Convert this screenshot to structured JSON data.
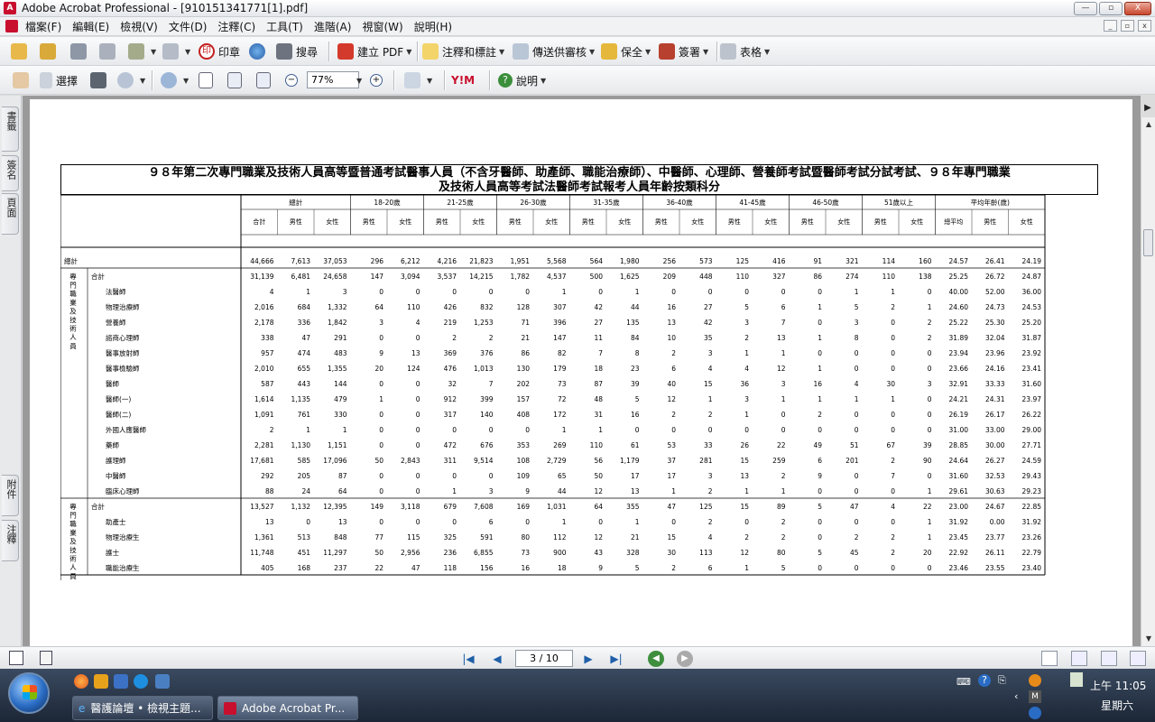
{
  "window": {
    "title": "Adobe Acrobat Professional - [910151341771[1].pdf]",
    "min": "—",
    "max": "▫",
    "close": "X"
  },
  "menubar": {
    "items": [
      "檔案(F)",
      "編輯(E)",
      "檢視(V)",
      "文件(D)",
      "注釋(C)",
      "工具(T)",
      "進階(A)",
      "視窗(W)",
      "說明(H)"
    ]
  },
  "toolbar1": {
    "stamp": "印章",
    "search": "搜尋",
    "create_pdf": "建立 PDF",
    "comment": "注釋和標註",
    "review": "傳送供審核",
    "secure": "保全",
    "sign": "簽署",
    "forms": "表格"
  },
  "toolbar2": {
    "select": "選擇",
    "zoom": "77%",
    "help": "說明"
  },
  "leftnav": {
    "tabs": [
      "書籤",
      "簽名",
      "頁面",
      "附件",
      "注釋"
    ]
  },
  "statusbar": {
    "page": "3 / 10"
  },
  "taskbar": {
    "items": [
      "醫護論壇 • 檢視主題...",
      "Adobe Acrobat Pr..."
    ],
    "time": "上午 11:05",
    "day": "星期六"
  },
  "document": {
    "title_line1": "９８年第二次專門職業及技術人員高等暨普通考試醫事人員（不含牙醫師、助產師、職能治療師）、中醫師、心理師、營養師考試暨醫師考試分試考試、９８年專門職業",
    "title_line2": "及技術人員高等考試法醫師考試報考人員年齡按類科分",
    "group_headers": [
      "總計",
      "18-20歲",
      "21-25歲",
      "26-30歲",
      "31-35歲",
      "36-40歲",
      "41-45歲",
      "46-50歲",
      "51歲以上",
      "平均年齡(歲)"
    ],
    "sub_headers": [
      "合計",
      "男性",
      "女性",
      "男性",
      "女性",
      "男性",
      "女性",
      "男性",
      "女性",
      "男性",
      "女性",
      "男性",
      "女性",
      "男性",
      "女性",
      "男性",
      "女性",
      "男性",
      "女性",
      "總平均",
      "男性",
      "女性"
    ],
    "total_label": "總計",
    "total_row": [
      "44,666",
      "7,613",
      "37,053",
      "296",
      "6,212",
      "4,216",
      "21,823",
      "1,951",
      "5,568",
      "564",
      "1,980",
      "256",
      "573",
      "125",
      "416",
      "91",
      "321",
      "114",
      "160",
      "24.57",
      "26.41",
      "24.19"
    ],
    "section1_label": "專門職業及技術人員高等考試",
    "section1_rows": [
      {
        "name": "合計",
        "v": [
          "31,139",
          "6,481",
          "24,658",
          "147",
          "3,094",
          "3,537",
          "14,215",
          "1,782",
          "4,537",
          "500",
          "1,625",
          "209",
          "448",
          "110",
          "327",
          "86",
          "274",
          "110",
          "138",
          "25.25",
          "26.72",
          "24.87"
        ]
      },
      {
        "name": "法醫師",
        "v": [
          "4",
          "1",
          "3",
          "0",
          "0",
          "0",
          "0",
          "0",
          "1",
          "0",
          "1",
          "0",
          "0",
          "0",
          "0",
          "0",
          "1",
          "1",
          "0",
          "40.00",
          "52.00",
          "36.00"
        ]
      },
      {
        "name": "物理治療師",
        "v": [
          "2,016",
          "684",
          "1,332",
          "64",
          "110",
          "426",
          "832",
          "128",
          "307",
          "42",
          "44",
          "16",
          "27",
          "5",
          "6",
          "1",
          "5",
          "2",
          "1",
          "24.60",
          "24.73",
          "24.53"
        ]
      },
      {
        "name": "營養師",
        "v": [
          "2,178",
          "336",
          "1,842",
          "3",
          "4",
          "219",
          "1,253",
          "71",
          "396",
          "27",
          "135",
          "13",
          "42",
          "3",
          "7",
          "0",
          "3",
          "0",
          "2",
          "25.22",
          "25.30",
          "25.20"
        ]
      },
      {
        "name": "諮商心理師",
        "v": [
          "338",
          "47",
          "291",
          "0",
          "0",
          "2",
          "2",
          "21",
          "147",
          "11",
          "84",
          "10",
          "35",
          "2",
          "13",
          "1",
          "8",
          "0",
          "2",
          "31.89",
          "32.04",
          "31.87"
        ]
      },
      {
        "name": "醫事放射師",
        "v": [
          "957",
          "474",
          "483",
          "9",
          "13",
          "369",
          "376",
          "86",
          "82",
          "7",
          "8",
          "2",
          "3",
          "1",
          "1",
          "0",
          "0",
          "0",
          "0",
          "23.94",
          "23.96",
          "23.92"
        ]
      },
      {
        "name": "醫事檢驗師",
        "v": [
          "2,010",
          "655",
          "1,355",
          "20",
          "124",
          "476",
          "1,013",
          "130",
          "179",
          "18",
          "23",
          "6",
          "4",
          "4",
          "12",
          "1",
          "0",
          "0",
          "0",
          "23.66",
          "24.16",
          "23.41"
        ]
      },
      {
        "name": "醫師",
        "v": [
          "587",
          "443",
          "144",
          "0",
          "0",
          "32",
          "7",
          "202",
          "73",
          "87",
          "39",
          "40",
          "15",
          "36",
          "3",
          "16",
          "4",
          "30",
          "3",
          "32.91",
          "33.33",
          "31.60"
        ]
      },
      {
        "name": "醫師(一)",
        "v": [
          "1,614",
          "1,135",
          "479",
          "1",
          "0",
          "912",
          "399",
          "157",
          "72",
          "48",
          "5",
          "12",
          "1",
          "3",
          "1",
          "1",
          "1",
          "1",
          "0",
          "24.21",
          "24.31",
          "23.97"
        ]
      },
      {
        "name": "醫師(二)",
        "v": [
          "1,091",
          "761",
          "330",
          "0",
          "0",
          "317",
          "140",
          "408",
          "172",
          "31",
          "16",
          "2",
          "2",
          "1",
          "0",
          "2",
          "0",
          "0",
          "0",
          "26.19",
          "26.17",
          "26.22"
        ]
      },
      {
        "name": "外國人應醫師",
        "v": [
          "2",
          "1",
          "1",
          "0",
          "0",
          "0",
          "0",
          "0",
          "1",
          "1",
          "0",
          "0",
          "0",
          "0",
          "0",
          "0",
          "0",
          "0",
          "0",
          "31.00",
          "33.00",
          "29.00"
        ]
      },
      {
        "name": "藥師",
        "v": [
          "2,281",
          "1,130",
          "1,151",
          "0",
          "0",
          "472",
          "676",
          "353",
          "269",
          "110",
          "61",
          "53",
          "33",
          "26",
          "22",
          "49",
          "51",
          "67",
          "39",
          "28.85",
          "30.00",
          "27.71"
        ]
      },
      {
        "name": "護理師",
        "v": [
          "17,681",
          "585",
          "17,096",
          "50",
          "2,843",
          "311",
          "9,514",
          "108",
          "2,729",
          "56",
          "1,179",
          "37",
          "281",
          "15",
          "259",
          "6",
          "201",
          "2",
          "90",
          "24.64",
          "26.27",
          "24.59"
        ]
      },
      {
        "name": "中醫師",
        "v": [
          "292",
          "205",
          "87",
          "0",
          "0",
          "0",
          "0",
          "109",
          "65",
          "50",
          "17",
          "17",
          "3",
          "13",
          "2",
          "9",
          "0",
          "7",
          "0",
          "31.60",
          "32.53",
          "29.43"
        ]
      },
      {
        "name": "臨床心理師",
        "v": [
          "88",
          "24",
          "64",
          "0",
          "0",
          "1",
          "3",
          "9",
          "44",
          "12",
          "13",
          "1",
          "2",
          "1",
          "1",
          "0",
          "0",
          "0",
          "1",
          "29.61",
          "30.63",
          "29.23"
        ]
      }
    ],
    "section2_label": "專門職業及技術人員普通考試",
    "section2_rows": [
      {
        "name": "合計",
        "v": [
          "13,527",
          "1,132",
          "12,395",
          "149",
          "3,118",
          "679",
          "7,608",
          "169",
          "1,031",
          "64",
          "355",
          "47",
          "125",
          "15",
          "89",
          "5",
          "47",
          "4",
          "22",
          "23.00",
          "24.67",
          "22.85"
        ]
      },
      {
        "name": "助產士",
        "v": [
          "13",
          "0",
          "13",
          "0",
          "0",
          "0",
          "6",
          "0",
          "1",
          "0",
          "1",
          "0",
          "2",
          "0",
          "2",
          "0",
          "0",
          "0",
          "1",
          "31.92",
          "0.00",
          "31.92"
        ]
      },
      {
        "name": "物理治療生",
        "v": [
          "1,361",
          "513",
          "848",
          "77",
          "115",
          "325",
          "591",
          "80",
          "112",
          "12",
          "21",
          "15",
          "4",
          "2",
          "2",
          "0",
          "2",
          "2",
          "1",
          "23.45",
          "23.77",
          "23.26"
        ]
      },
      {
        "name": "護士",
        "v": [
          "11,748",
          "451",
          "11,297",
          "50",
          "2,956",
          "236",
          "6,855",
          "73",
          "900",
          "43",
          "328",
          "30",
          "113",
          "12",
          "80",
          "5",
          "45",
          "2",
          "20",
          "22.92",
          "26.11",
          "22.79"
        ]
      },
      {
        "name": "職能治療生",
        "v": [
          "405",
          "168",
          "237",
          "22",
          "47",
          "118",
          "156",
          "16",
          "18",
          "9",
          "5",
          "2",
          "6",
          "1",
          "5",
          "0",
          "0",
          "0",
          "0",
          "23.46",
          "23.55",
          "23.40"
        ]
      }
    ]
  }
}
